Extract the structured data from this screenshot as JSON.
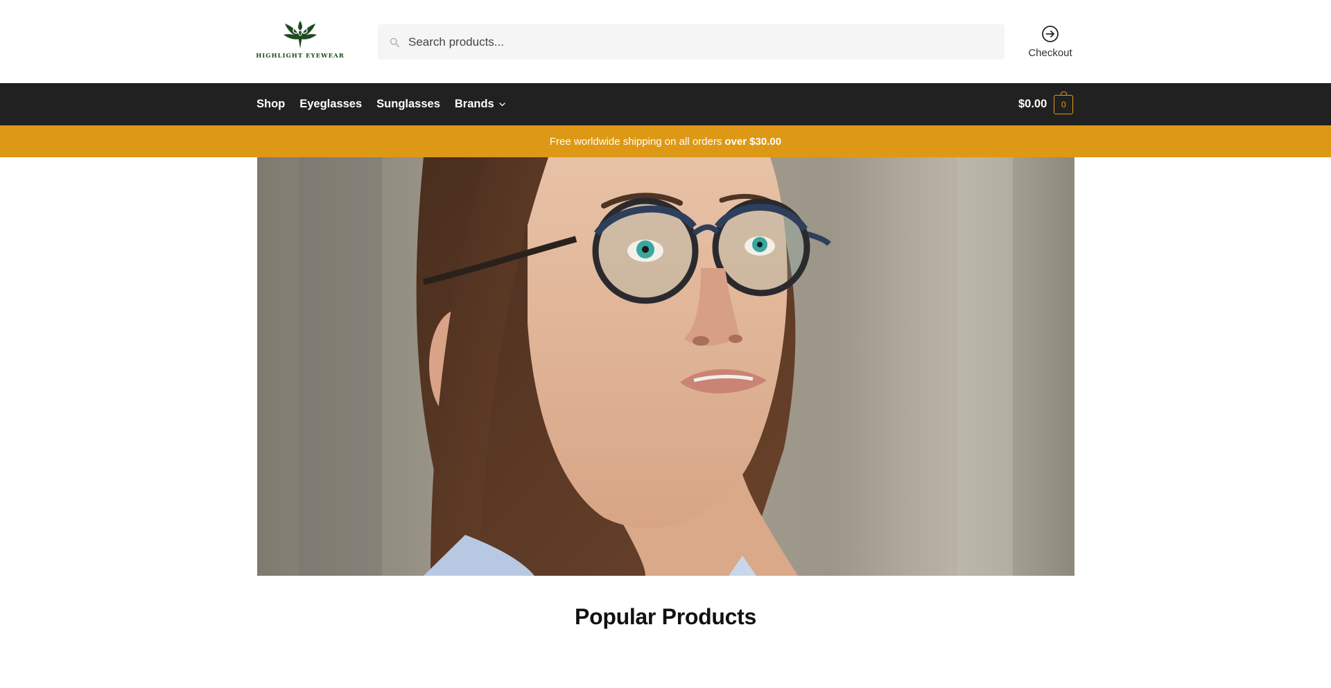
{
  "header": {
    "logo_text": "HIGHLIGHT EYEWEAR",
    "logo_alt": "Highlight Eyewear logo",
    "search": {
      "placeholder": "Search products...",
      "value": ""
    },
    "checkout_label": "Checkout"
  },
  "nav": {
    "items": [
      {
        "label": "Shop"
      },
      {
        "label": "Eyeglasses"
      },
      {
        "label": "Sunglasses"
      },
      {
        "label": "Brands",
        "has_dropdown": true
      }
    ],
    "cart": {
      "total": "$0.00",
      "count": "0"
    }
  },
  "promo": {
    "text": "Free worldwide shipping on all orders",
    "highlight": "over $30.00"
  },
  "hero": {
    "alt": "Woman wearing round dark eyeglasses looking upward"
  },
  "section": {
    "title": "Popular Products"
  },
  "colors": {
    "navbar_bg": "#212121",
    "promo_bg": "#dd9915",
    "accent": "#e09a1a",
    "logo_green": "#1d4a1f"
  },
  "icons": {
    "search": "search-icon",
    "checkout": "arrow-circle-right-icon",
    "dropdown": "chevron-down-icon",
    "cart": "shopping-bag-icon"
  }
}
